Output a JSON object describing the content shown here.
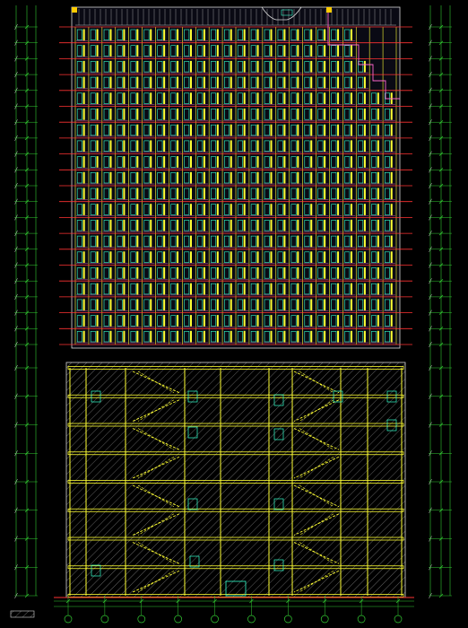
{
  "drawing": {
    "type": "architectural-section-elevation",
    "tower_floors": 20,
    "podium_floors": 8,
    "tower_bays": 24,
    "grid_axes": 10,
    "legend_label": "",
    "scale_note": "",
    "colors": {
      "background": "#000000",
      "dimension": "#33cc33",
      "floor_line": "#ff3333",
      "window": "#33ffcc",
      "mullion": "#ffff33",
      "frame": "#ff66cc",
      "hatch": "#b4b4b4",
      "accent": "#3399ff"
    }
  }
}
